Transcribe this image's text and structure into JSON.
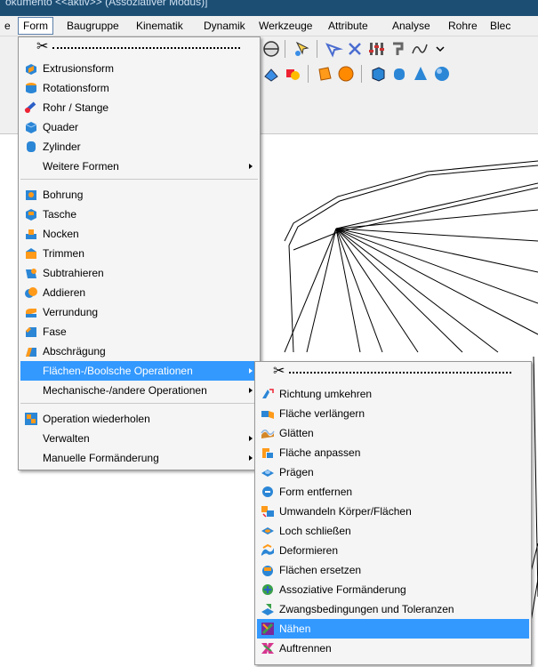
{
  "window": {
    "title": "okumento    <<aktiv>> (Assoziativer Modus)]"
  },
  "menubar": [
    "e",
    "Form",
    "Baugruppe",
    "Kinematik",
    "Dynamik",
    "Werkzeuge",
    "Attribute",
    "Analyse",
    "Rohre",
    "Blec"
  ],
  "form_menu": {
    "items": [
      {
        "label": "Extrusionsform",
        "icon": "extrusion-icon"
      },
      {
        "label": "Rotationsform",
        "icon": "rotation-icon"
      },
      {
        "label": "Rohr / Stange",
        "icon": "pipe-icon"
      },
      {
        "label": "Quader",
        "icon": "cuboid-icon"
      },
      {
        "label": "Zylinder",
        "icon": "cylinder-icon"
      },
      {
        "label": "Weitere Formen",
        "submenu": true
      },
      {
        "label": "Bohrung",
        "icon": "hole-icon"
      },
      {
        "label": "Tasche",
        "icon": "pocket-icon"
      },
      {
        "label": "Nocken",
        "icon": "boss-icon"
      },
      {
        "label": "Trimmen",
        "icon": "trim-icon"
      },
      {
        "label": "Subtrahieren",
        "icon": "subtract-icon"
      },
      {
        "label": "Addieren",
        "icon": "add-icon"
      },
      {
        "label": "Verrundung",
        "icon": "fillet-icon"
      },
      {
        "label": "Fase",
        "icon": "chamfer-icon"
      },
      {
        "label": "Abschrägung",
        "icon": "draft-icon"
      },
      {
        "label": "Flächen-/Boolsche Operationen",
        "submenu": true,
        "highlighted": true
      },
      {
        "label": "Mechanische-/andere Operationen",
        "submenu": true
      },
      {
        "label": "Operation wiederholen",
        "icon": "repeat-icon"
      },
      {
        "label": "Verwalten",
        "submenu": true
      },
      {
        "label": "Manuelle Formänderung",
        "submenu": true
      }
    ]
  },
  "surface_menu": {
    "items": [
      {
        "label": "Richtung umkehren",
        "icon": "reverse-direction-icon"
      },
      {
        "label": "Fläche verlängern",
        "icon": "extend-surface-icon"
      },
      {
        "label": "Glätten",
        "icon": "smooth-icon"
      },
      {
        "label": "Fläche anpassen",
        "icon": "match-surface-icon"
      },
      {
        "label": "Prägen",
        "icon": "emboss-icon"
      },
      {
        "label": "Form entfernen",
        "icon": "remove-shape-icon"
      },
      {
        "label": "Umwandeln Körper/Flächen",
        "icon": "convert-icon"
      },
      {
        "label": "Loch schließen",
        "icon": "close-hole-icon"
      },
      {
        "label": "Deformieren",
        "icon": "deform-icon"
      },
      {
        "label": "Flächen ersetzen",
        "icon": "replace-faces-icon"
      },
      {
        "label": "Assoziative Formänderung",
        "icon": "associative-icon"
      },
      {
        "label": "Zwangsbedingungen und Toleranzen",
        "icon": "constraints-icon"
      },
      {
        "label": "Nähen",
        "icon": "stitch-icon",
        "highlighted": true
      },
      {
        "label": "Auftrennen",
        "icon": "split-icon"
      }
    ]
  }
}
